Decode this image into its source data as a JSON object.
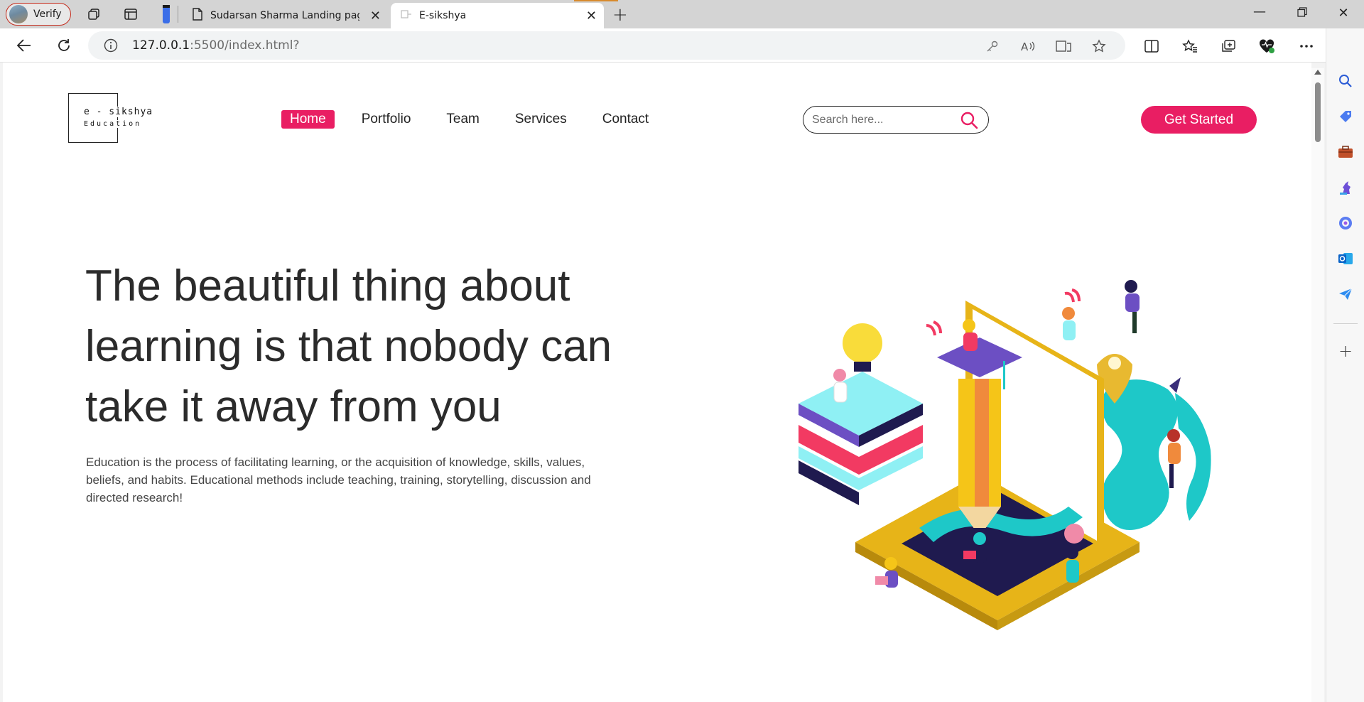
{
  "browser": {
    "profile_label": "Verify",
    "tabs": [
      {
        "title": "Sudarsan Sharma Landing page |",
        "active": false
      },
      {
        "title": "E-sikshya",
        "active": true
      }
    ],
    "url_host": "127.0.0.1",
    "url_rest": ":5500/index.html?"
  },
  "site": {
    "logo": {
      "name": "e - sikshya",
      "subtitle": "Education"
    },
    "nav": [
      {
        "label": "Home",
        "active": true
      },
      {
        "label": "Portfolio",
        "active": false
      },
      {
        "label": "Team",
        "active": false
      },
      {
        "label": "Services",
        "active": false
      },
      {
        "label": "Contact",
        "active": false
      }
    ],
    "search_placeholder": "Search here...",
    "cta_label": "Get Started",
    "hero": {
      "title": "The beautiful thing about learning is that nobody can take it away from you",
      "description": "Education is the process of facilitating learning, or the acquisition of knowledge, skills, values, beliefs, and habits. Educational methods include teaching, training, storytelling, discussion and directed research!"
    }
  },
  "colors": {
    "accent": "#e91e63",
    "text": "#2b2b2b"
  },
  "icons": {
    "sidebar": [
      "search-icon",
      "tag-icon",
      "briefcase-icon",
      "chess-icon",
      "copilot-icon",
      "outlook-icon",
      "send-icon",
      "add-icon"
    ],
    "toolbar": [
      "key-icon",
      "read-aloud-icon",
      "immersive-reader-icon",
      "favorite-star-icon",
      "split-screen-icon",
      "favorites-icon",
      "collections-icon",
      "browser-essentials-icon",
      "more-icon",
      "copilot-icon"
    ]
  }
}
